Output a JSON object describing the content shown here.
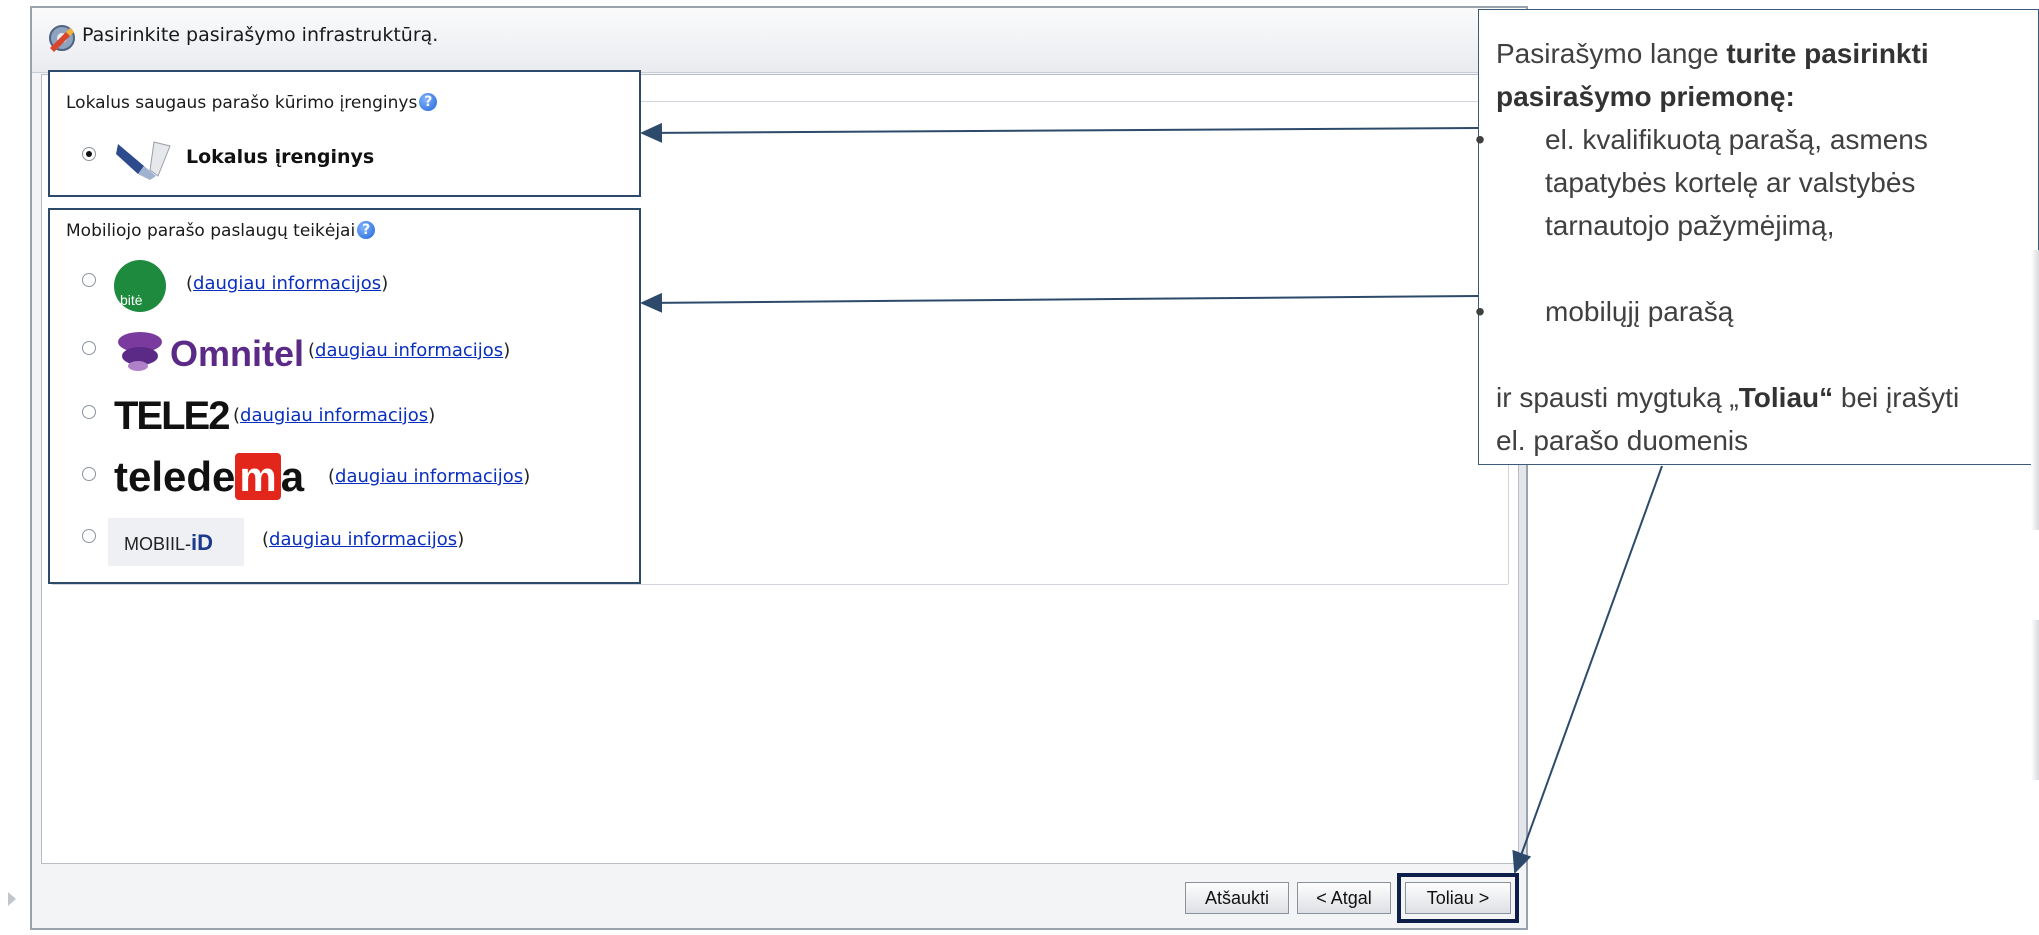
{
  "dialog": {
    "title": "Pasirinkite pasirašymo infrastruktūrą.",
    "title_icon": "signature-gear-icon"
  },
  "local_group": {
    "legend": "Lokalus saugaus parašo kūrimo įrenginys",
    "option_label": "Lokalus įrenginys",
    "option_icon": "usb-token-icon",
    "selected": true
  },
  "mobile_group": {
    "legend": "Mobiliojo parašo paslaugų teikėjai",
    "providers": [
      {
        "logo_text": "bitė",
        "link": "daugiau informacijos"
      },
      {
        "logo_text": "Omnitel",
        "link": "daugiau informacijos"
      },
      {
        "logo_text": "TELE2",
        "link": "daugiau informacijos"
      },
      {
        "logo_text_a": "telede",
        "logo_text_b": "m",
        "logo_text_c": "a",
        "link": "daugiau informacijos"
      },
      {
        "logo_text_a": "MOBIIL-",
        "logo_text_b": "iD",
        "link": "daugiau informacijos"
      }
    ]
  },
  "buttons": {
    "cancel": "Atšaukti",
    "back": "< Atgal",
    "next": "Toliau >"
  },
  "callout": {
    "line1_a": "Pasirašymo lange ",
    "line1_b": "turite pasirinkti",
    "line2": "pasirašymo priemonę:",
    "bullet1_l1": "el. kvalifikuotą parašą, asmens",
    "bullet1_l2": "tapatybės kortelę ar valstybės",
    "bullet1_l3": "tarnautojo pažymėjimą,",
    "bullet2": "mobilųjį parašą",
    "line3_a": "ir spausti mygtuką „",
    "line3_b": "Toliau“",
    "line3_c": " bei įrašyti",
    "line4": "el. parašo duomenis",
    "bullet_char": "•"
  },
  "colors": {
    "frame": "#2d4a6b",
    "highlight": "#0e1e4a",
    "link": "#0a2fbf",
    "callout_text": "#404040"
  }
}
